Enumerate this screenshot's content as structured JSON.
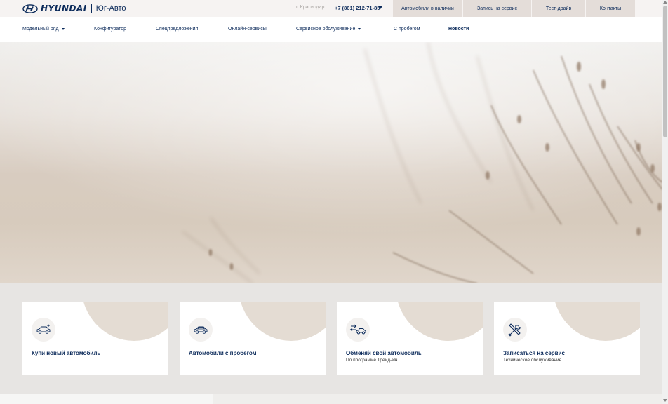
{
  "header": {
    "brand": "HYUNDAI",
    "dealer": "Юг-Авто",
    "city": "г. Краснодар",
    "phone": "+7 (861) 212-71-85",
    "buttons": [
      {
        "label": "Автомобили в наличии"
      },
      {
        "label": "Запись на сервис"
      },
      {
        "label": "Тест-драйв"
      },
      {
        "label": "Контакты"
      }
    ]
  },
  "nav": {
    "items": [
      {
        "label": "Модельный ряд",
        "dropdown": true
      },
      {
        "label": "Конфигуратор"
      },
      {
        "label": "Спецпредложения"
      },
      {
        "label": "Онлайн-сервисы"
      },
      {
        "label": "Сервисное обслуживание",
        "dropdown": true
      },
      {
        "label": "С пробегом"
      },
      {
        "label": "Новости",
        "active": true
      }
    ]
  },
  "cards": [
    {
      "title": "Купи новый автомобиль",
      "subtitle": "",
      "icon": "new-car-icon"
    },
    {
      "title": "Автомобили с пробегом",
      "subtitle": "",
      "icon": "used-car-icon"
    },
    {
      "title": "Обменяй свой автомобиль",
      "subtitle": "По программе Трейд-Ин",
      "icon": "trade-in-icon"
    },
    {
      "title": "Записаться на сервис",
      "subtitle": "Техническое обслуживание",
      "icon": "service-tools-icon"
    }
  ],
  "colors": {
    "brand": "#002c5f",
    "topbar_bg": "#f6f3f2",
    "button_bg": "#e4ddd9",
    "card_accent": "#e4dcd3",
    "page_bg": "#e7e5e3"
  }
}
